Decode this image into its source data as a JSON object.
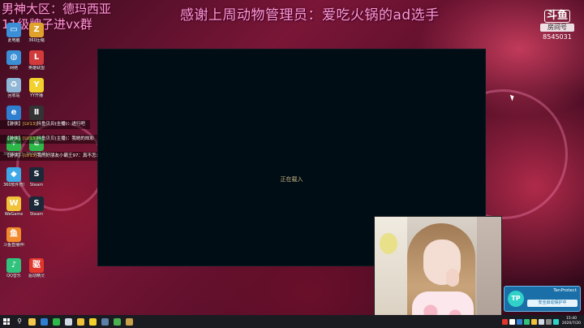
{
  "overlay": {
    "top_left_line1": "男神大区：德玛西亚",
    "top_left_line2": "11级牌子进vx群",
    "top_banner": "感谢上周动物管理员：爱吃火锅的ad选手"
  },
  "platform": {
    "logo": "斗鱼",
    "room_label": "房间号",
    "room_id": "8545031"
  },
  "desktop_icons": [
    {
      "label": "此电脑",
      "color": "#3b8fd6",
      "glyph": "▭"
    },
    {
      "label": "360压缩",
      "color": "#e0a22c",
      "glyph": "Z"
    },
    {
      "label": "网络",
      "color": "#3b8fd6",
      "glyph": "◍"
    },
    {
      "label": "英雄联盟",
      "color": "#d23b3b",
      "glyph": "L"
    },
    {
      "label": "回收站",
      "color": "#8fb7d6",
      "glyph": "♻"
    },
    {
      "label": "YY开播",
      "color": "#f2d12c",
      "glyph": "Y"
    },
    {
      "label": "",
      "color": "#2f7fd0",
      "glyph": "e"
    },
    {
      "label": "",
      "color": "#333333",
      "glyph": "Ⅱ"
    },
    {
      "label": "360安全卫士",
      "color": "#2fb84a",
      "glyph": "+"
    },
    {
      "label": "360安全浏览",
      "color": "#2fb84a",
      "glyph": "e"
    },
    {
      "label": "360软件管家",
      "color": "#3fa9e8",
      "glyph": "◆"
    },
    {
      "label": "Steam",
      "color": "#1b2838",
      "glyph": "S"
    },
    {
      "label": "WeGame",
      "color": "#f0c23a",
      "glyph": "W"
    },
    {
      "label": "Steam",
      "color": "#1b2838",
      "glyph": "S"
    },
    {
      "label": "斗鱼直播伴侣",
      "color": "#f08a2c",
      "glyph": "鱼"
    },
    {
      "label": "QQ音乐",
      "color": "#31c27c",
      "glyph": "♪"
    },
    {
      "label": "驱动精灵",
      "color": "#e0362c",
      "glyph": "驱"
    }
  ],
  "chat": [
    {
      "prefix": "【游侠】",
      "level": "[LV13]",
      "user": "抖鱼贝贝(主播)：",
      "text": "进行吧"
    },
    {
      "prefix": "【游侠】",
      "level": "[LV13]",
      "user": "抖鱼贝贝(主播)：",
      "text": "我她的炫彩"
    },
    {
      "prefix": "【游侠】",
      "level": "[LV13]",
      "user": "我的好朋友小霸王97：",
      "text": "真不怎么样"
    }
  ],
  "loading_window": {
    "text": "正在载入"
  },
  "notification": {
    "badge": "TP",
    "title": "TenProtect",
    "message": "安全启动保护中"
  },
  "taskbar": {
    "apps": [
      {
        "name": "file-explorer",
        "color": "#f2c94c"
      },
      {
        "name": "edge",
        "color": "#2f7fd0"
      },
      {
        "name": "360-browser",
        "color": "#2fb84a"
      },
      {
        "name": "qq",
        "color": "#cfd8e3"
      },
      {
        "name": "wegame",
        "color": "#f0c23a"
      },
      {
        "name": "yy",
        "color": "#f2d12c"
      },
      {
        "name": "steam",
        "color": "#5b7fa6"
      },
      {
        "name": "app-green",
        "color": "#4caf50"
      },
      {
        "name": "league-client",
        "color": "#c9a14a"
      }
    ],
    "time": "15:40",
    "date": "2020/7/20"
  }
}
